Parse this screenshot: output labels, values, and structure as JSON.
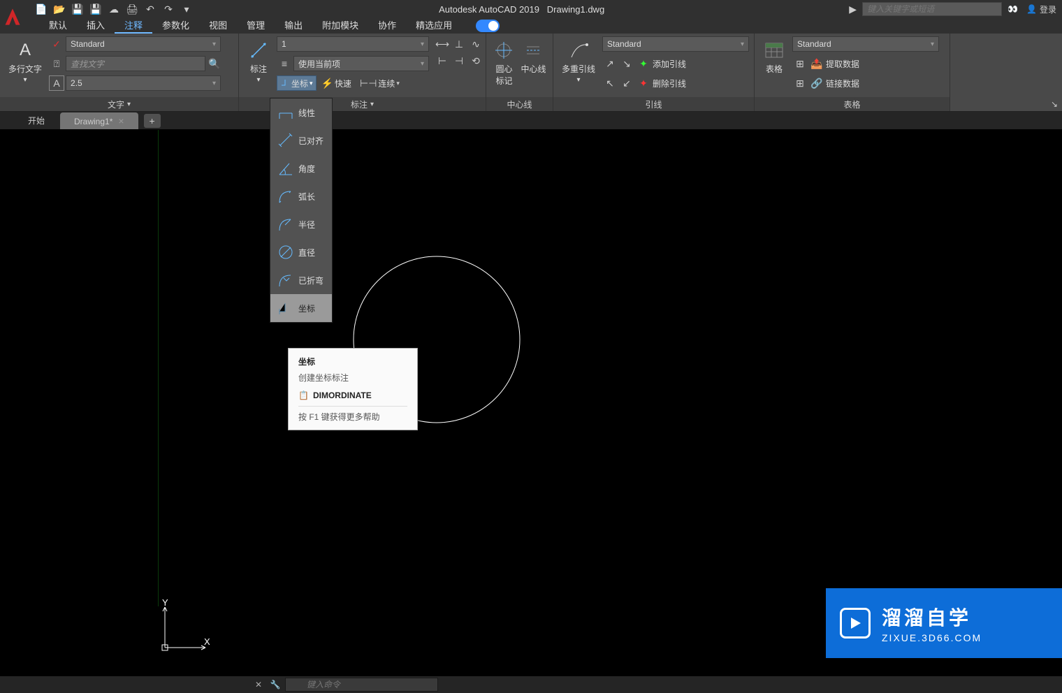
{
  "title": {
    "app": "Autodesk AutoCAD 2019",
    "doc": "Drawing1.dwg"
  },
  "search": {
    "placeholder": "键入关键字或短语"
  },
  "login": {
    "label": "登录"
  },
  "ribbon_tabs": [
    "默认",
    "插入",
    "注释",
    "参数化",
    "视图",
    "管理",
    "输出",
    "附加模块",
    "协作",
    "精选应用"
  ],
  "ribbon_active_index": 2,
  "panels": {
    "text": {
      "label": "文字",
      "main_btn": "多行文字",
      "style_value": "Standard",
      "find_placeholder": "查找文字",
      "height_value": "2.5"
    },
    "dim": {
      "label": "标注",
      "scale_value": "1",
      "match_label": "使用当前项",
      "coord_btn": "坐标",
      "quick_btn": "快速",
      "continue_btn": "连续",
      "main_btn": "标注"
    },
    "center": {
      "label": "中心线",
      "mark_btn": "圆心\n标记",
      "line_btn": "中心线"
    },
    "leader": {
      "label": "引线",
      "main_btn": "多重引线",
      "style_value": "Standard",
      "add": "添加引线",
      "remove": "删除引线"
    },
    "table": {
      "label": "表格",
      "main_btn": "表格",
      "style_value": "Standard",
      "extract": "提取数据",
      "link": "链接数据"
    }
  },
  "file_tabs": {
    "start": "开始",
    "active": "Drawing1*"
  },
  "dim_menu": [
    "线性",
    "已对齐",
    "角度",
    "弧长",
    "半径",
    "直径",
    "已折弯",
    "坐标"
  ],
  "tooltip": {
    "title": "坐标",
    "sub": "创建坐标标注",
    "cmd": "DIMORDINATE",
    "foot": "按 F1 键获得更多帮助"
  },
  "cmd": {
    "placeholder": "键入命令"
  },
  "watermark": {
    "zh": "溜溜自学",
    "en": "ZIXUE.3D66.COM"
  }
}
